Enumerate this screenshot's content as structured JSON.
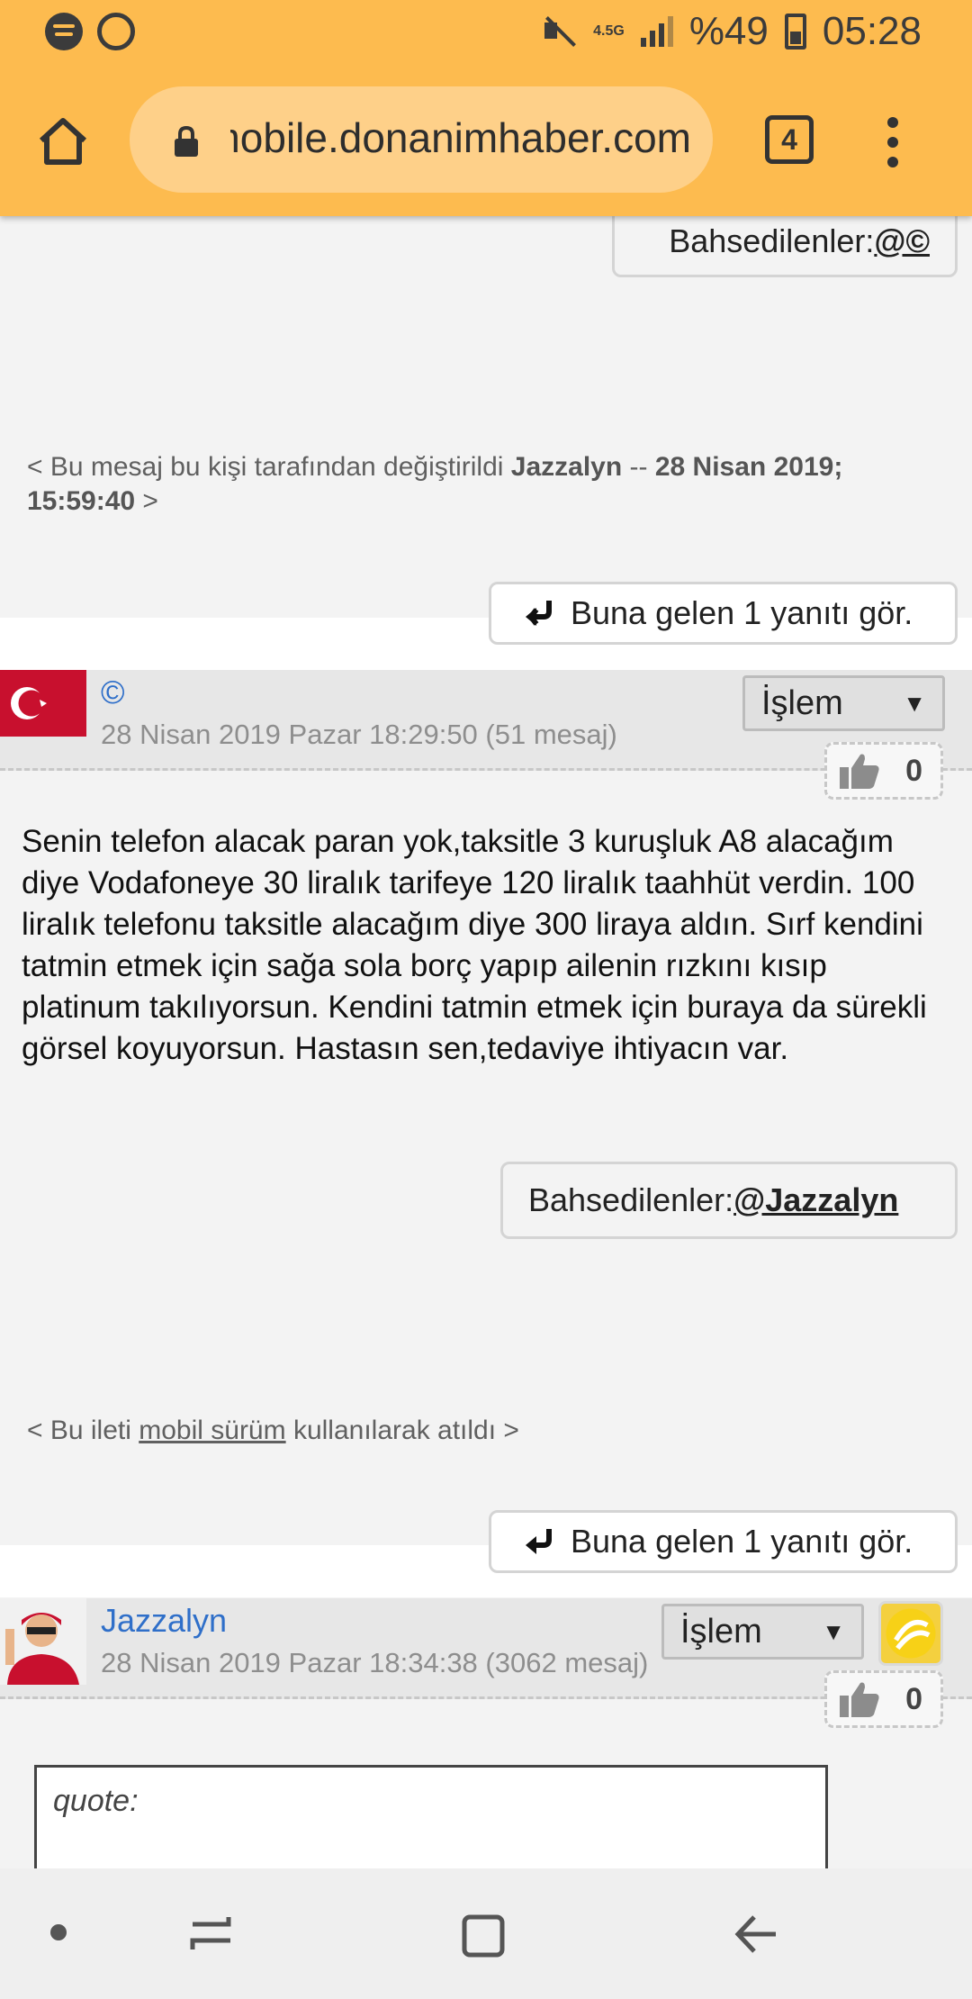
{
  "status_bar": {
    "network": "4.5G",
    "battery": "%49",
    "time": "05:28"
  },
  "browser": {
    "url": "mobile.donanimhaber.com",
    "tab_count": "4"
  },
  "top_mention": {
    "label": "Bahsedilenler: ",
    "user": "@©"
  },
  "edit_note": {
    "prefix": "< Bu mesaj bu kişi tarafından değiştirildi ",
    "user": "Jazzalyn",
    "separator": " -- ",
    "date": "28 Nisan 2019; 15:59:40",
    "suffix": " >"
  },
  "reply_button_1": "Buna gelen 1 yanıtı gör.",
  "post_1": {
    "user": "©",
    "date": "28 Nisan 2019 Pazar 18:29:50 (51 mesaj)",
    "action": "İşlem",
    "likes": "0",
    "body": "Senin telefon alacak paran yok,taksitle 3 kuruşluk A8 alacağım diye Vodafoneye 30 liralık tarifeye 120 liralık taahhüt verdin. 100 liralık telefonu taksitle alacağım diye 300 liraya aldın. Sırf kendini tatmin etmek için sağa sola borç yapıp ailenin rızkını kısıp platinum takılıyorsun. Kendini tatmin etmek için buraya da sürekli görsel koyuyorsun. Hastasın sen,tedaviye ihtiyacın var.",
    "mention_label": "Bahsedilenler: ",
    "mention_user": "@Jazzalyn",
    "mobile_note_prefix": "< Bu ileti ",
    "mobile_note_link": "mobil sürüm",
    "mobile_note_suffix": " kullanılarak atıldı >"
  },
  "reply_button_2": "Buna gelen 1 yanıtı gör.",
  "post_2": {
    "user": "Jazzalyn",
    "date": "28 Nisan 2019 Pazar 18:34:38 (3062 mesaj)",
    "action": "İşlem",
    "likes": "0",
    "quote_label": "quote:"
  },
  "colors": {
    "browser_bar": "#fdbb4f",
    "url_box": "#fed089",
    "username": "#2f6fc9"
  }
}
